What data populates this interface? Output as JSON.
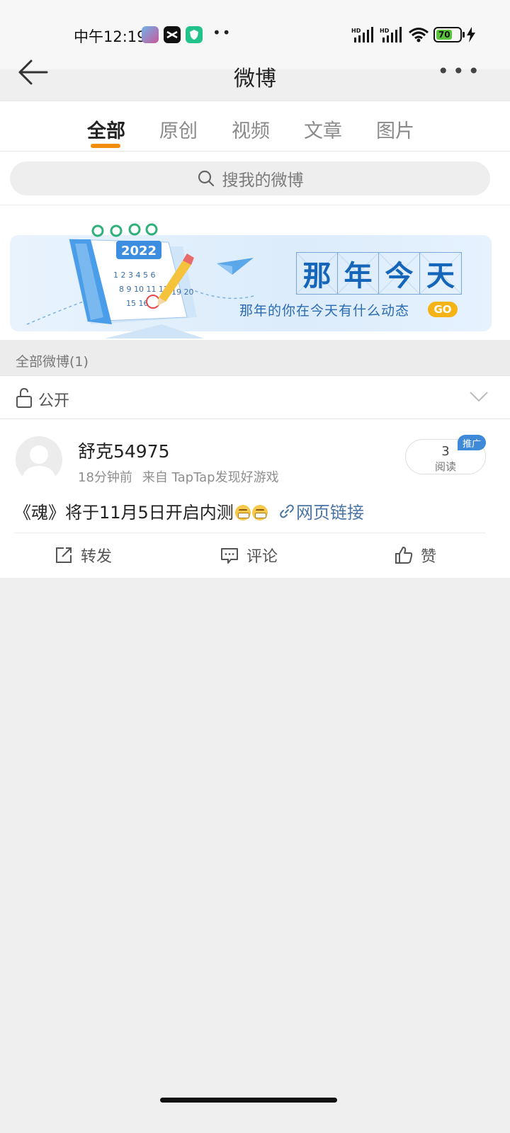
{
  "status_bar": {
    "time": "中午12:19",
    "battery": "70",
    "network": "HD"
  },
  "nav": {
    "title": "微博"
  },
  "tabs": [
    {
      "label": "全部",
      "active": true
    },
    {
      "label": "原创",
      "active": false
    },
    {
      "label": "视频",
      "active": false
    },
    {
      "label": "文章",
      "active": false
    },
    {
      "label": "图片",
      "active": false
    }
  ],
  "search": {
    "placeholder": "搜我的微博"
  },
  "banner": {
    "title_chars": [
      "那",
      "年",
      "今",
      "天"
    ],
    "subtitle": "那年的你在今天有什么动态",
    "go_label": "GO",
    "calendar_year": "2022"
  },
  "section": {
    "header": "全部微博(1)"
  },
  "privacy": {
    "label": "公开"
  },
  "post": {
    "username": "舒克54975",
    "time_ago": "18分钟前",
    "source": "来自 TapTap发现好游戏",
    "read_count": "3",
    "read_label": "阅读",
    "promo_badge": "推广",
    "text": "《魂》将于11月5日开启内测",
    "link_label": "网页链接",
    "actions": {
      "repost": "转发",
      "comment": "评论",
      "like": "赞"
    }
  },
  "colors": {
    "accent": "#f28c0d",
    "link": "#4b75a7",
    "badge": "#3f8ad8",
    "banner_title": "#1565b8",
    "go": "#f5b316"
  }
}
